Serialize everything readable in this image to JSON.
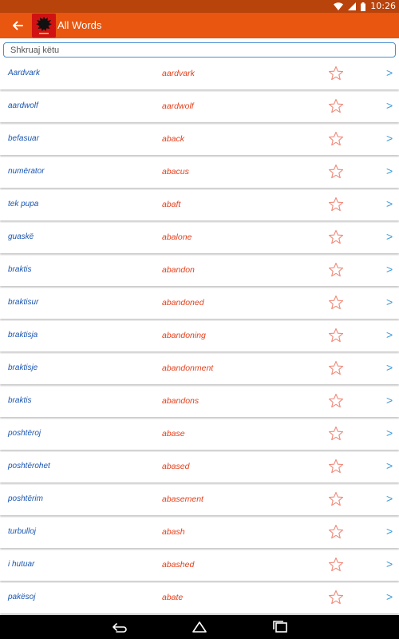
{
  "status_bar": {
    "time": "10:26",
    "icons": [
      "wifi-icon",
      "signal-icon",
      "battery-icon"
    ]
  },
  "app_bar": {
    "back_icon": "arrow-left-icon",
    "logo": "albanian-flag-eagle-logo",
    "title": "All Words"
  },
  "search": {
    "placeholder": "Shkruaj këtu",
    "value": ""
  },
  "words": [
    {
      "albanian": "Aardvark",
      "english": "aardvark"
    },
    {
      "albanian": "aardwolf",
      "english": "aardwolf"
    },
    {
      "albanian": "befasuar",
      "english": "aback"
    },
    {
      "albanian": "numërator",
      "english": "abacus"
    },
    {
      "albanian": "tek pupa",
      "english": "abaft"
    },
    {
      "albanian": "guaskë",
      "english": "abalone"
    },
    {
      "albanian": "braktis",
      "english": "abandon"
    },
    {
      "albanian": "braktisur",
      "english": "abandoned"
    },
    {
      "albanian": "braktisja",
      "english": "abandoning"
    },
    {
      "albanian": "braktisje",
      "english": "abandonment"
    },
    {
      "albanian": "braktis",
      "english": "abandons"
    },
    {
      "albanian": "poshtëroj",
      "english": "abase"
    },
    {
      "albanian": "poshtërohet",
      "english": "abased"
    },
    {
      "albanian": "poshtërim",
      "english": "abasement"
    },
    {
      "albanian": "turbulloj",
      "english": "abash"
    },
    {
      "albanian": "i hutuar",
      "english": "abashed"
    },
    {
      "albanian": "pakësoj",
      "english": "abate"
    }
  ],
  "row_icons": {
    "favorite": "star-outline-icon",
    "open": "chevron-right-icon",
    "open_glyph": ">"
  },
  "nav_bar": {
    "icons": [
      "back-nav-icon",
      "home-nav-icon",
      "recents-nav-icon"
    ]
  },
  "colors": {
    "status_bar": "#b8430b",
    "app_bar": "#e8560f",
    "albanian_text": "#1b56b0",
    "english_text": "#e3401c",
    "star": "#f08a7a",
    "chevron": "#3d9ad8",
    "search_border": "#4a8fd0"
  }
}
